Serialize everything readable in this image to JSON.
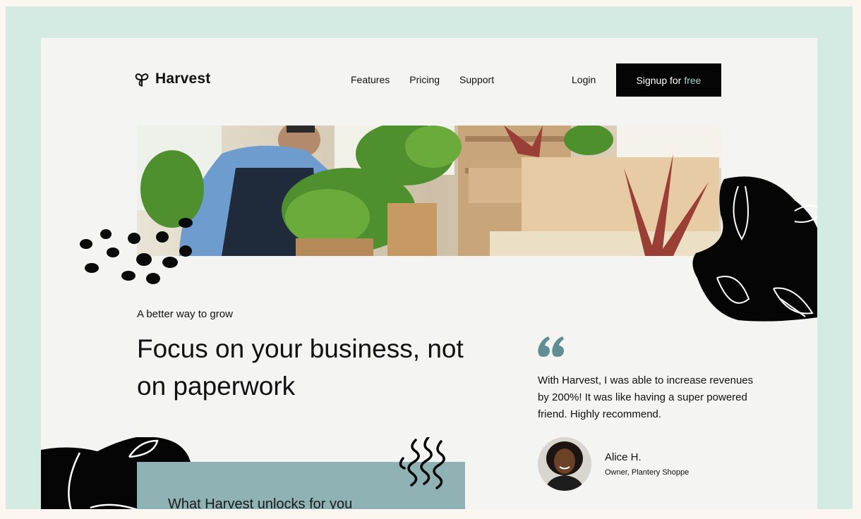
{
  "brand": {
    "name": "Harvest",
    "logo_icon": "leaf-logo-icon"
  },
  "nav": {
    "items": [
      "Features",
      "Pricing",
      "Support"
    ],
    "login": "Login"
  },
  "signup": {
    "label": "Signup for",
    "accent": "free",
    "accent_color": "#9fd6cb"
  },
  "hero": {
    "eyebrow": "A better way to grow",
    "headline": "Focus on your business, not on paperwork"
  },
  "unlock": {
    "title": "What Harvest unlocks for you"
  },
  "testimonial": {
    "quote": "With Harvest, I was able to increase revenues by 200%! It was like having a super powered friend. Highly recommend.",
    "author": "Alice H.",
    "role": "Owner, Plantery Shoppe",
    "quote_color": "#5f8f93"
  },
  "colors": {
    "frame": "#d4ebe4",
    "page": "#f4f4f2",
    "unlock_box": "#8fb2b5",
    "button": "#050505"
  }
}
